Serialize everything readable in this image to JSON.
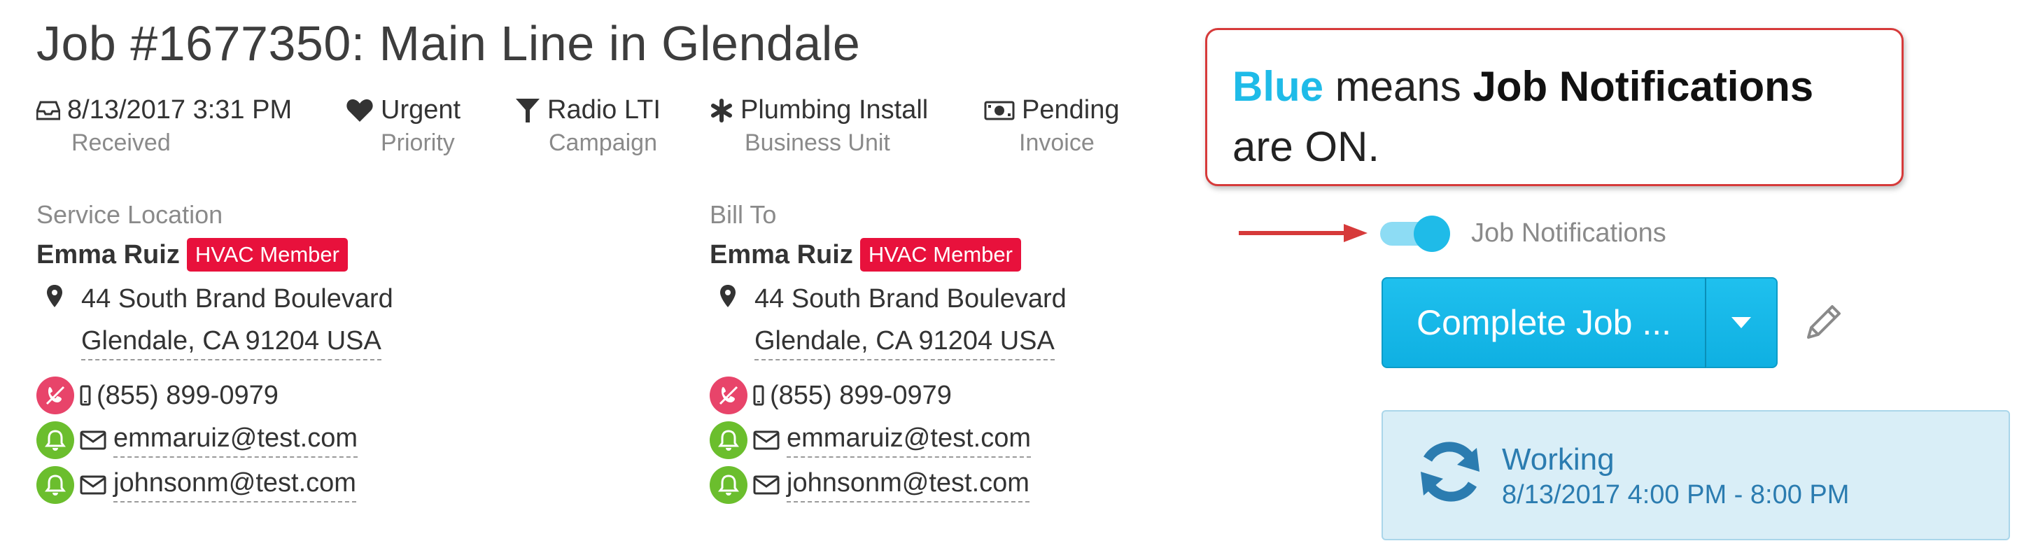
{
  "job": {
    "title": "Job #1677350: Main Line in Glendale"
  },
  "meta": [
    {
      "icon": "inbox-icon",
      "value": "8/13/2017 3:31 PM",
      "label": "Received"
    },
    {
      "icon": "heart-icon",
      "value": "Urgent",
      "label": "Priority"
    },
    {
      "icon": "funnel-icon",
      "value": "Radio LTI",
      "label": "Campaign"
    },
    {
      "icon": "asterisk-icon",
      "value": "Plumbing Install",
      "label": "Business Unit"
    },
    {
      "icon": "money-icon",
      "value": "Pending",
      "label": "Invoice"
    }
  ],
  "service_location": {
    "heading": "Service Location",
    "name": "Emma Ruiz",
    "badge": "HVAC Member",
    "address_line1": "44 South Brand Boulevard",
    "address_line2": "Glendale, CA 91204 USA",
    "phone": "(855) 899-0979",
    "emails": [
      "emmaruiz@test.com",
      "johnsonm@test.com"
    ]
  },
  "bill_to": {
    "heading": "Bill To",
    "name": "Emma Ruiz",
    "badge": "HVAC Member",
    "address_line1": "44 South Brand Boulevard",
    "address_line2": "Glendale, CA 91204 USA",
    "phone": "(855) 899-0979",
    "emails": [
      "emmaruiz@test.com",
      "johnsonm@test.com"
    ]
  },
  "callout": {
    "blue_word": "Blue",
    "means": " means ",
    "bold": "Job Notifications",
    "rest": "are ON."
  },
  "notifications": {
    "label": "Job Notifications",
    "enabled": true
  },
  "actions": {
    "complete_label": "Complete Job ..."
  },
  "status": {
    "title": "Working",
    "time": "8/13/2017 4:00 PM - 8:00 PM"
  },
  "colors": {
    "accent_blue": "#1fbbe8",
    "badge_red": "#e8113c",
    "callout_border": "#d63a3a",
    "status_bg": "#d9eef7",
    "status_text": "#2b7cb0",
    "bell_green": "#6bbe2d",
    "no_call_red": "#e8446a"
  }
}
